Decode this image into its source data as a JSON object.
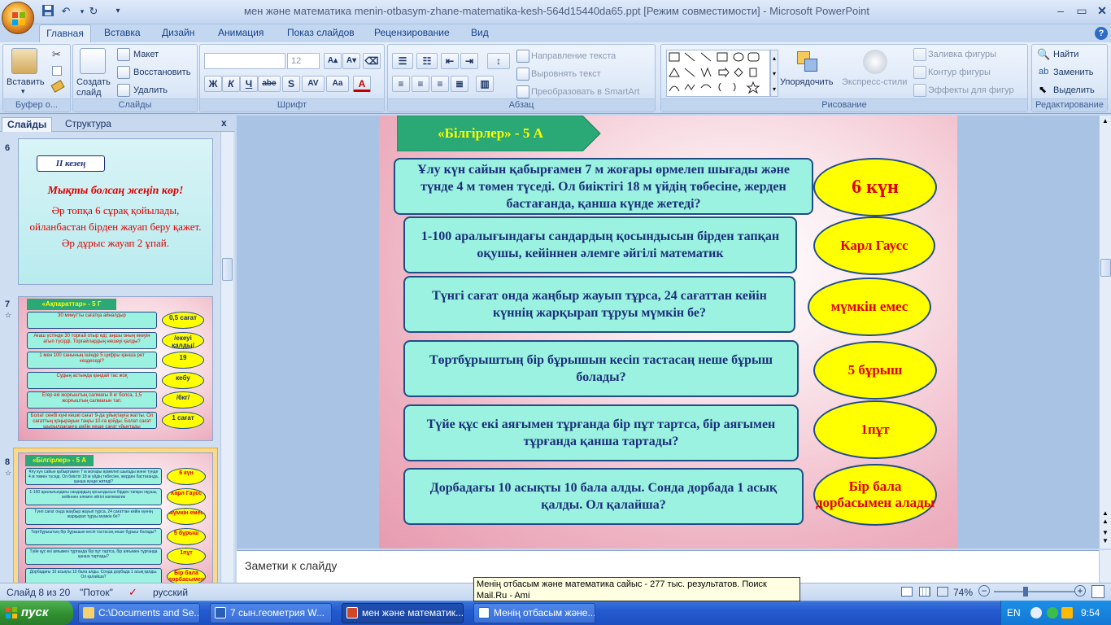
{
  "window": {
    "title": "мен және математика menin-otbasym-zhane-matematika-kesh-564d15440da65.ppt [Режим совместимости] - Microsoft PowerPoint",
    "qat_icons": [
      "save-icon",
      "undo-icon",
      "redo-icon",
      "customize-qat-icon"
    ],
    "controls": [
      "minimize-icon",
      "maximize-icon",
      "close-icon"
    ]
  },
  "tabs": [
    "Главная",
    "Вставка",
    "Дизайн",
    "Анимация",
    "Показ слайдов",
    "Рецензирование",
    "Вид"
  ],
  "active_tab": "Главная",
  "help": "?",
  "ribbon": {
    "clipboard": {
      "paste": "Вставить",
      "label": "Буфер о..."
    },
    "slides": {
      "new_slide": "Создать слайд",
      "layout": "Макет",
      "reset": "Восстановить",
      "delete": "Удалить",
      "label": "Слайды"
    },
    "font": {
      "size": "12",
      "label": "Шрифт",
      "buttons": [
        "Ж",
        "К",
        "Ч",
        "abe",
        "S",
        "AV",
        "Aa",
        "A"
      ]
    },
    "paragraph": {
      "text_direction": "Направление текста",
      "align_text": "Выровнять текст",
      "smartart": "Преобразовать в SmartArt",
      "label": "Абзац"
    },
    "drawing": {
      "arrange": "Упорядочить",
      "quick_styles": "Экспресс-стили",
      "fill": "Заливка фигуры",
      "outline": "Контур фигуры",
      "effects": "Эффекты для фигур",
      "label": "Рисование"
    },
    "editing": {
      "find": "Найти",
      "replace": "Заменить",
      "select": "Выделить",
      "label": "Редактирование"
    }
  },
  "left_pane": {
    "tabs": [
      "Слайды",
      "Структура"
    ],
    "close": "x",
    "slides": [
      {
        "num": "6",
        "badge": "ІІ кезең",
        "title": "Мықты болсаң жеңіп көр!",
        "lines": [
          "Әр топқа 6 сұрақ қойылады,",
          "ойланбастан бірден жауап беру қажет.",
          "Әр дұрыс жауап 2 ұпай."
        ]
      },
      {
        "num": "7",
        "header": "«Ақпараттар» - 5 Г",
        "rows": [
          {
            "q": "30 минутты сағатқа айналдыр",
            "a": "0,5 сағат"
          },
          {
            "q": "Ағаш үстінде 30 торғай отыр еді, аңшы оның екеуін атып түсірді. Торғайлардың нешеуі қалды?",
            "a": "/екеуі қалды/"
          },
          {
            "q": "1 мен 100 санының ішінде 5 цифры қанша рет кездеседі?",
            "a": "19"
          },
          {
            "q": "Судың астында қандай тас жоқ",
            "a": "кебу"
          },
          {
            "q": "Егер екі жорғыштың салмағы 8 кг болса, 1,5 жорғыштың салмағын тап.",
            "a": "/6кг/"
          },
          {
            "q": "Болат сенбі күні кешкі сағат 9-да ұйықтауға жатты. Ол сағаттың қоңырауын таңғы 10-ға қойды. Болат сағат шырылдағанға дейін неше сағат ұйықтады",
            "a": "1 сағат"
          }
        ]
      },
      {
        "num": "8",
        "header": "«Білгірлер» - 5 А"
      }
    ]
  },
  "slide": {
    "header": "«Білгірлер» - 5 А",
    "rows": [
      {
        "question": "Ұлу күн сайын қабырғамен 7 м жоғары өрмелеп шығады және түнде 4 м төмен түседі. Ол биіктігі 18 м үйдің төбесіне, жерден бастағанда, қанша күнде жетеді?",
        "answer": "6 күн"
      },
      {
        "question": "1-100 аралығындағы сандардың қосындысын бірден тапқан оқушы, кейіннен әлемге әйгілі математик",
        "answer": "Карл Гаусс"
      },
      {
        "question": "Түнгі сағат онда жаңбыр жауып тұрса, 24 сағаттан кейін күннің жарқырап тұруы мүмкін бе?",
        "answer": "мүмкін емес"
      },
      {
        "question": "Төртбұрыштың бір бұрышын кесіп тастасаң неше бұрыш болады?",
        "answer": "5 бұрыш"
      },
      {
        "question": "Түйе құс екі аяғымен тұрғанда бір пұт тартса, бір аяғымен тұрғанда қанша тартады?",
        "answer": "1пұт"
      },
      {
        "question": "Дорбадағы 10 асықты 10 бала алды. Сонда дорбада 1 асық қалды. Ол қалайша?",
        "answer": "Бір бала дорбасымен алады"
      }
    ]
  },
  "notes_placeholder": "Заметки к слайду",
  "status": {
    "slide": "Слайд 8 из 20",
    "theme": "\"Поток\"",
    "language": "русский",
    "zoom": "74%"
  },
  "tooltip": "Менің отбасым және математика сайыс - 277 тыс. результатов. Поиск Mail.Ru - Ami",
  "taskbar": {
    "start": "пуск",
    "tasks": [
      "C:\\Documents and Se...",
      "7 сын.геометрия  W...",
      "мен және математик...",
      "Менің отбасым және..."
    ],
    "lang": "EN",
    "time": "9:54"
  },
  "colors": {
    "question_fill": "#9bf2e0",
    "answer_fill": "#ffff00",
    "answer_text": "#e00000",
    "header_fill": "#2aa876",
    "header_text": "#ffff00"
  }
}
